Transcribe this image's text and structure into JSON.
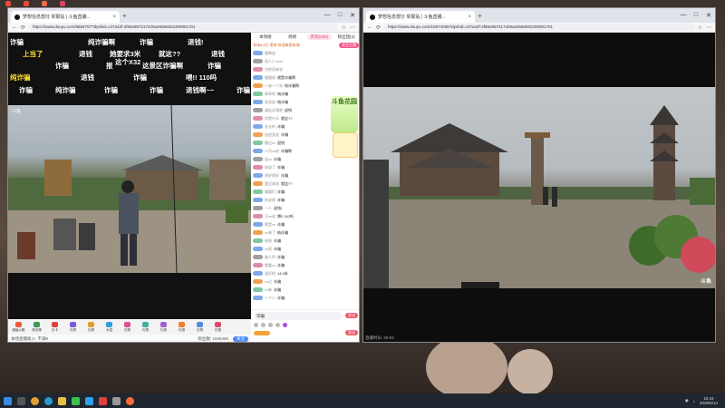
{
  "left_window": {
    "tab_title": "梦想信息部分 举报站 | 斗鱼直播...",
    "url": "https://www.douyu.com/9692787?dyshid=c37a42f-2f65e957217429a2659eb02300001701",
    "danmu": [
      {
        "text": "诈骗",
        "color": "white"
      },
      {
        "text": "纯诈骗啊",
        "color": "white"
      },
      {
        "text": "诈骗",
        "color": "white"
      },
      {
        "text": "退钱!",
        "color": "white"
      },
      {
        "text": "上当了",
        "color": "yellow"
      },
      {
        "text": "退钱",
        "color": "white"
      },
      {
        "text": "她要求3米",
        "color": "white"
      },
      {
        "text": "就这??",
        "color": "white"
      },
      {
        "text": "退钱",
        "color": "white"
      },
      {
        "text": "诈骗",
        "color": "white"
      },
      {
        "text": "这个X32",
        "color": "white"
      },
      {
        "text": "报",
        "color": "white"
      },
      {
        "text": "这景区诈骗啊",
        "color": "white"
      },
      {
        "text": "诈骗",
        "color": "white"
      },
      {
        "text": "纯诈骗",
        "color": "yellow"
      },
      {
        "text": "退钱",
        "color": "white"
      },
      {
        "text": "诈骗",
        "color": "white"
      },
      {
        "text": "喂!! 110吗",
        "color": "white"
      },
      {
        "text": "诈骗",
        "color": "white"
      },
      {
        "text": "纯诈骗",
        "color": "white"
      },
      {
        "text": "诈骗",
        "color": "white"
      },
      {
        "text": "诈骗",
        "color": "white"
      },
      {
        "text": "退钱啊~~",
        "color": "white"
      },
      {
        "text": "诈骗",
        "color": "white"
      }
    ],
    "video_watermark": "斗鱼",
    "gifts": [
      "超级火箭",
      "荧光棒",
      "办卡",
      "礼物",
      "礼物",
      "大招",
      "礼物",
      "礼物",
      "礼物",
      "礼物",
      "礼物",
      "礼物"
    ],
    "status_left": "本场直播收入: 不满8",
    "status_mid": "粉丝数: 1045466",
    "status_btn": "关注",
    "chat": {
      "tabs": [
        "本场榜",
        "周榜",
        "贵宾(200)",
        "粉丝团(4)"
      ],
      "notice": "本场6.8万 贵宾 欢迎来到本场",
      "notice_btn": "关注主播",
      "promo_text": "斗鱼花园",
      "messages": [
        {
          "name": "猫咪说",
          "text": ""
        },
        {
          "name": "双人C.xxxx",
          "text": ""
        },
        {
          "name": "为你而来说",
          "text": ""
        },
        {
          "name": "猫猫说",
          "text": "就是诈骗啊"
        },
        {
          "name": "一米一个米",
          "text": "纯诈骗啊"
        },
        {
          "name": "乖乖咩",
          "text": "纯诈骗"
        },
        {
          "name": "花花说",
          "text": "纯诈骗"
        },
        {
          "name": "请告诉我吧",
          "text": "退钱"
        },
        {
          "name": "你是什么",
          "text": "就这??"
        },
        {
          "name": "长长的",
          "text": "诈骗"
        },
        {
          "name": "自由女说",
          "text": "诈骗"
        },
        {
          "name": "路过xx",
          "text": "退钱"
        },
        {
          "name": "八月xx说",
          "text": "诈骗啊"
        },
        {
          "name": "这xx",
          "text": "诈骗"
        },
        {
          "name": "快说了",
          "text": "诈骗"
        },
        {
          "name": "很好很好",
          "text": "诈骗"
        },
        {
          "name": "我过来说",
          "text": "就这??"
        },
        {
          "name": "猫猫们",
          "text": "诈骗"
        },
        {
          "name": "你说呢",
          "text": "诈骗"
        },
        {
          "name": "一人",
          "text": "退钱!"
        },
        {
          "name": "又xx说",
          "text": "喂!! 110吗"
        },
        {
          "name": "那是xx",
          "text": "诈骗"
        },
        {
          "name": "xx来了",
          "text": "纯诈骗"
        },
        {
          "name": "哈哈",
          "text": "诈骗"
        },
        {
          "name": "xx说",
          "text": "诈骗"
        },
        {
          "name": "路人甲",
          "text": "诈骗"
        },
        {
          "name": "看看xx",
          "text": "诈骗"
        },
        {
          "name": "说好的",
          "text": "14.3米"
        },
        {
          "name": "xx过",
          "text": "诈骗"
        },
        {
          "name": "xx来",
          "text": "诈骗"
        },
        {
          "name": "一个人",
          "text": "诈骗"
        }
      ],
      "input_value": "诈骗",
      "send_label": "发送",
      "send2_label": "发送"
    }
  },
  "right_window": {
    "tab_title": "梦想信息部分 举报站 | 斗鱼直播...",
    "url": "https://www.douyu.com/10674036?dyshid=c37a42f-2f65e957217429a2659eb02300001701",
    "video_watermark": "斗鱼",
    "info": "直播时长: 06:04"
  },
  "taskbar": {
    "time": "16:44",
    "date": "2025/6/14"
  }
}
